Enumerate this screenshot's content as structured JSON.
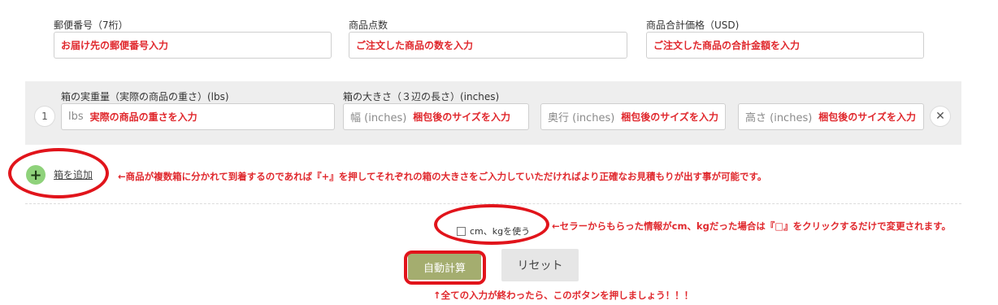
{
  "top_fields": [
    {
      "label": "郵便番号（7桁）",
      "hint": "お届け先の郵便番号入力"
    },
    {
      "label": "商品点数",
      "hint": "ご注文した商品の数を入力"
    },
    {
      "label": "商品合計価格（USD)",
      "hint": "ご注文した商品の合計金額を入力"
    }
  ],
  "box_row": {
    "number": "1",
    "weight_label": "箱の実重量（実際の商品の重さ）(lbs)",
    "weight_placeholder": "lbs",
    "weight_hint": "実際の商品の重さを入力",
    "size_label": "箱の大きさ（３辺の長さ）(inches)",
    "width_placeholder": "幅 (inches)",
    "depth_placeholder": "奥行 (inches)",
    "height_placeholder": "高さ (inches)",
    "size_hint": "梱包後のサイズを入力",
    "remove_symbol": "✕"
  },
  "add_box": {
    "symbol": "+",
    "label": "箱を追加",
    "note": "←商品が複数箱に分かれて到着するのであれば『+』を押してそれぞれの箱の大きさをご入力していただければより正確なお見積もりが出す事が可能です。"
  },
  "unit_toggle": {
    "label": "cm、kgを使う",
    "note": "←セラーからもらった情報がcm、kgだった場合は『□』をクリックするだけで変更されます。"
  },
  "buttons": {
    "calculate": "自動計算",
    "reset": "リセット"
  },
  "bottom_note": "↑全ての入力が終わったら、このボタンを押しましょう！！！",
  "colors": {
    "annotation_red": "#e1141b",
    "calc_button": "#a4ad6f",
    "plus_button": "#8fd27b"
  }
}
